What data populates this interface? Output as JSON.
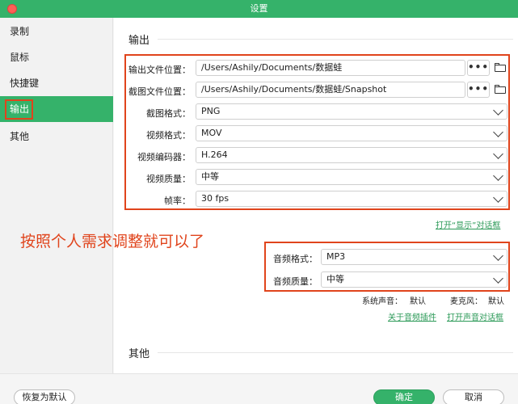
{
  "window": {
    "title": "设置"
  },
  "sidebar": {
    "items": [
      {
        "label": "录制"
      },
      {
        "label": "鼠标"
      },
      {
        "label": "快捷键"
      },
      {
        "label": "输出"
      },
      {
        "label": "其他"
      }
    ],
    "active_index": 3
  },
  "output": {
    "section_title": "输出",
    "output_path": {
      "label": "输出文件位置：",
      "value": "/Users/Ashily/Documents/数据蛙",
      "more": "•••"
    },
    "snapshot_path": {
      "label": "截图文件位置：",
      "value": "/Users/Ashily/Documents/数据蛙/Snapshot",
      "more": "•••"
    },
    "screenshot_format": {
      "label": "截图格式：",
      "value": "PNG"
    },
    "video_format": {
      "label": "视频格式：",
      "value": "MOV"
    },
    "video_codec": {
      "label": "视频编码器：",
      "value": "H.264"
    },
    "video_quality": {
      "label": "视频质量：",
      "value": "中等"
    },
    "frame_rate": {
      "label": "帧率：",
      "value": "30 fps"
    },
    "open_display_link": "打开“显示”对话框"
  },
  "annotation": "按照个人需求调整就可以了",
  "audio": {
    "format": {
      "label": "音频格式：",
      "value": "MP3"
    },
    "quality": {
      "label": "音频质量：",
      "value": "中等"
    },
    "system_sound_label": "系统声音：",
    "system_sound_value": "默认",
    "mic_label": "麦克风：",
    "mic_value": "默认",
    "plugin_link": "关于音频插件",
    "open_sound_link": "打开声音对话框"
  },
  "other": {
    "section_title": "其他"
  },
  "footer": {
    "restore_default": "恢复为默认",
    "ok": "确定",
    "cancel": "取消"
  }
}
